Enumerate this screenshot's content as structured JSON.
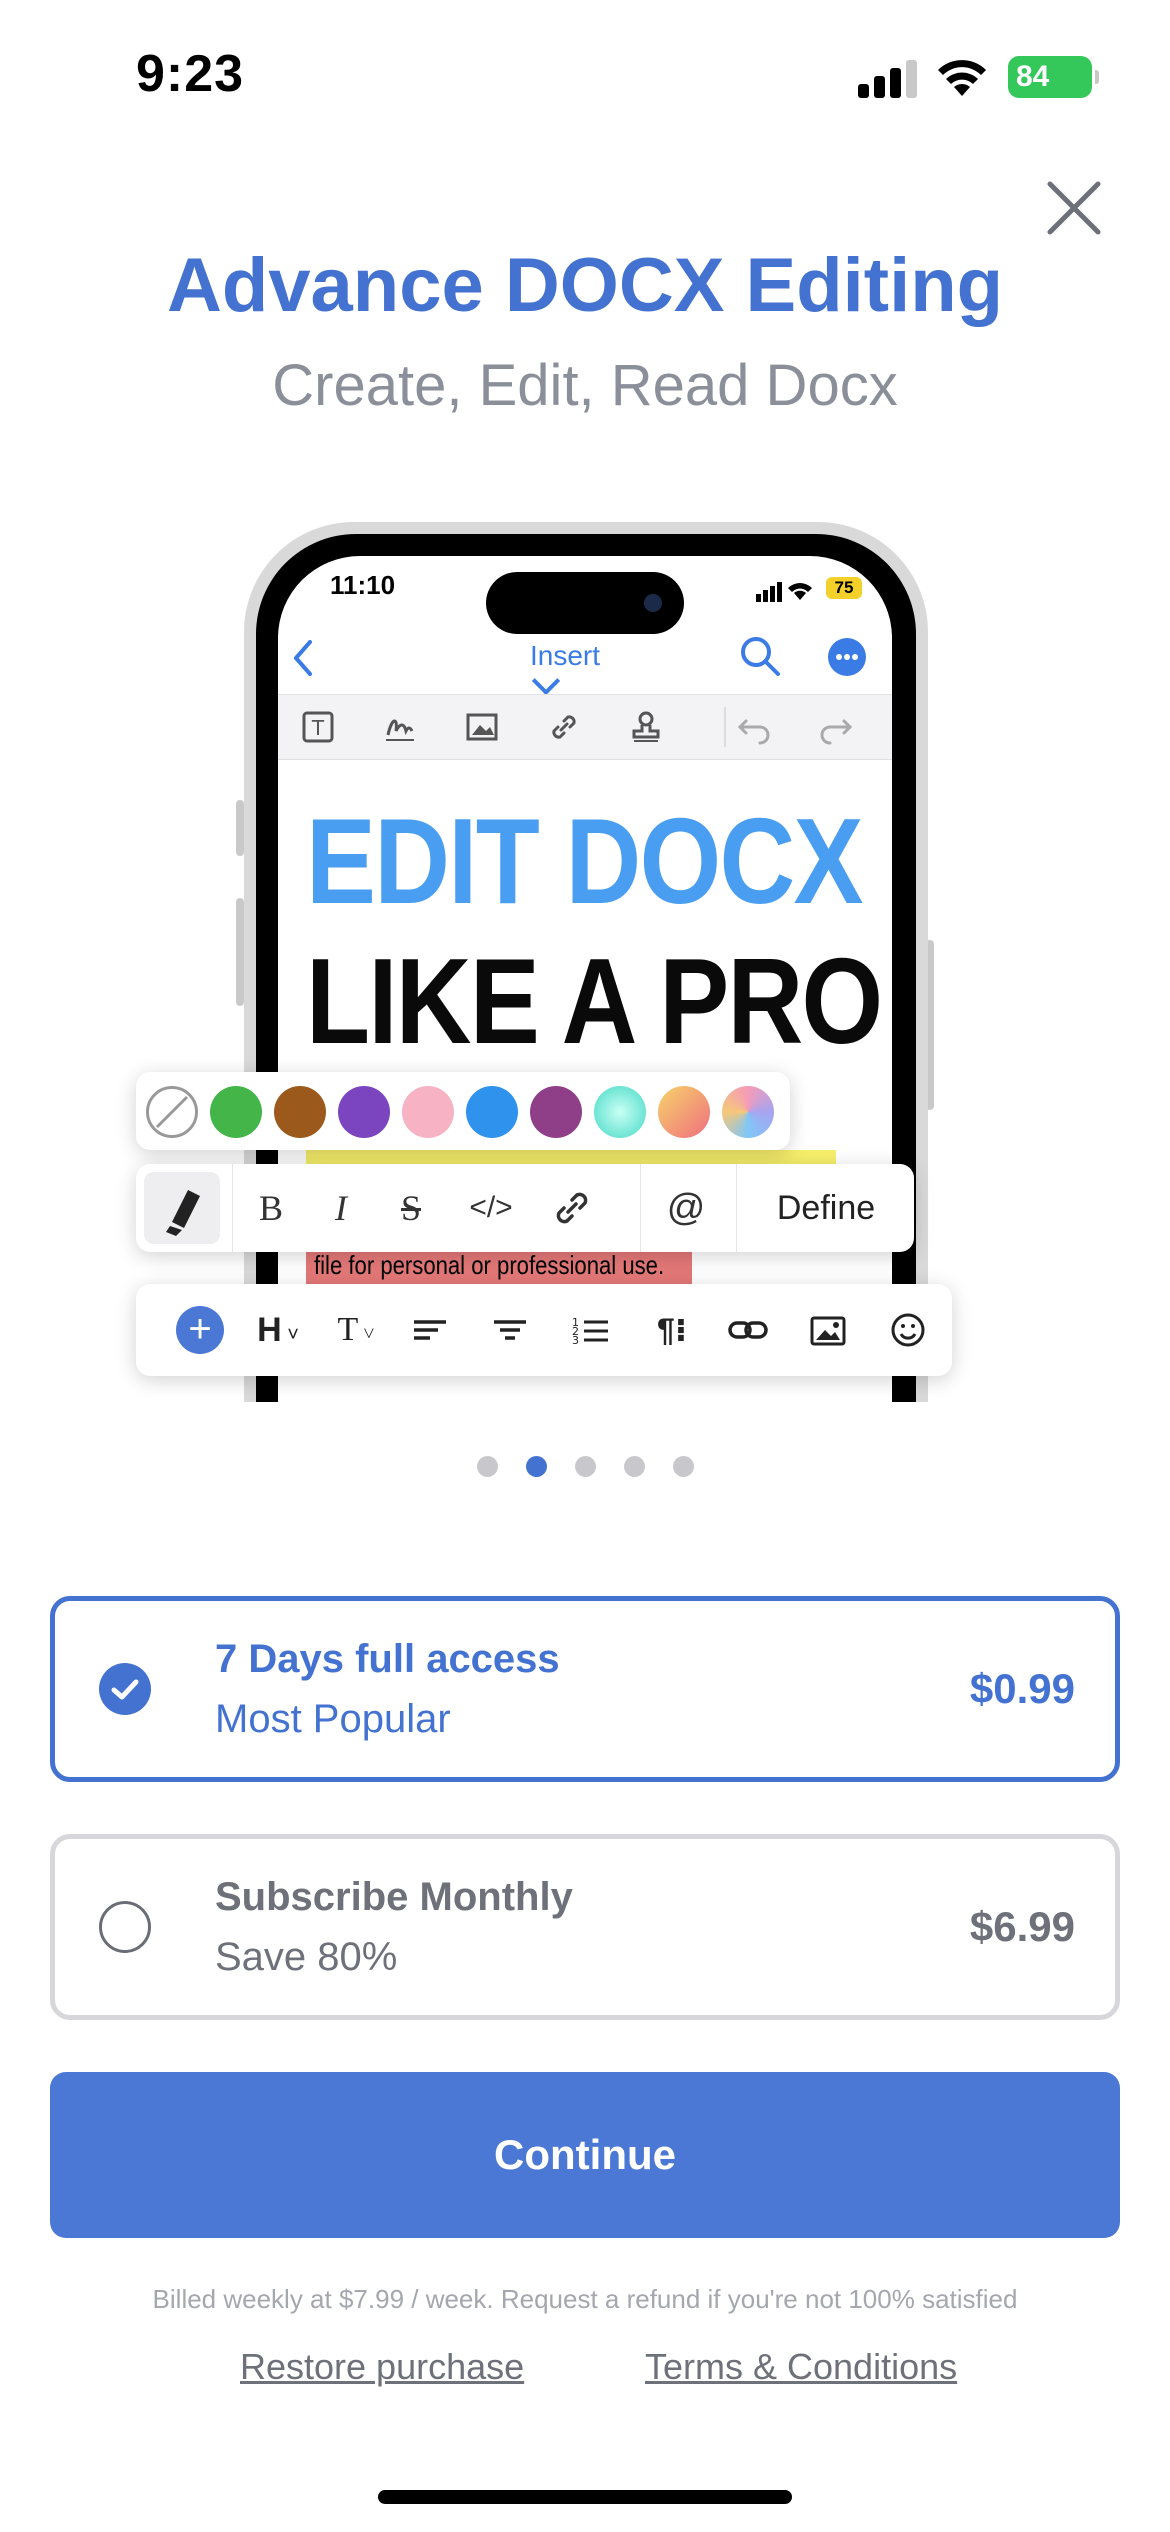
{
  "status_bar": {
    "time": "9:23",
    "battery": "84"
  },
  "header": {
    "title": "Advance DOCX Editing",
    "subtitle": "Create, Edit, Read Docx"
  },
  "preview": {
    "time": "11:10",
    "battery": "75",
    "nav_title": "Insert",
    "hero_line1": "EDIT DOCX",
    "hero_line2": "LIKE A PRO",
    "body_text": "file for personal or professional use.",
    "swatch_colors": [
      "#44b549",
      "#9b5a1c",
      "#7b45bf",
      "#f7b3c4",
      "#2f93ee",
      "#8f3f87",
      "#6ee7d5",
      "#f4a35c",
      "#a8a4f0"
    ],
    "format_tools": [
      "B",
      "I",
      "S",
      "</>",
      "@"
    ],
    "define_label": "Define",
    "bottom_tools": [
      "H",
      "T"
    ]
  },
  "carousel": {
    "count": 5,
    "active_index": 1
  },
  "plans": [
    {
      "name": "7 Days full access",
      "subtitle": "Most Popular",
      "price": "$0.99",
      "selected": true
    },
    {
      "name": "Subscribe Monthly",
      "subtitle": "Save 80%",
      "price": "$6.99",
      "selected": false
    }
  ],
  "cta": {
    "label": "Continue"
  },
  "footer": {
    "billing_note": "Billed weekly at $7.99 / week. Request a refund if you're not 100% satisfied",
    "restore_label": "Restore purchase",
    "terms_label": "Terms & Conditions"
  },
  "colors": {
    "accent": "#4472d0",
    "battery": "#34c759"
  }
}
